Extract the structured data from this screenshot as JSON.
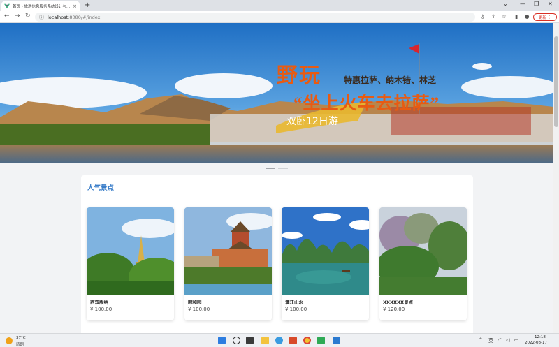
{
  "browser": {
    "tab_title": "首页 - 旅游信息服务系统设计与...",
    "tab_close": "×",
    "new_tab": "+",
    "url_host": "localhost",
    "url_rest": ":8080/#/index",
    "update_label": "更新",
    "window_controls": [
      "⌄",
      "—",
      "❐",
      "✕"
    ]
  },
  "banner": {
    "title": "野玩",
    "subtitle": "特惠拉萨、纳木错、林芝",
    "slogan": "“坐上火车去拉萨”",
    "days": "双卧12日游"
  },
  "section": {
    "title": "人气景点"
  },
  "spots": [
    {
      "name": "西双版纳",
      "price": "¥ 100.00"
    },
    {
      "name": "颐和园",
      "price": "¥ 100.00"
    },
    {
      "name": "漓江山水",
      "price": "¥ 100.00"
    },
    {
      "name": "XXXXXX景点",
      "price": "¥ 120.00"
    }
  ],
  "taskbar": {
    "temperature": "37°C",
    "weather": "晴朗",
    "ime": "英",
    "time": "12:18",
    "date": "2022-08-17"
  }
}
